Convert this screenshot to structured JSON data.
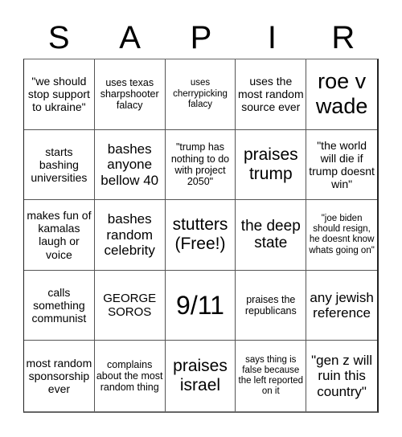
{
  "header": {
    "letters": [
      "S",
      "A",
      "P",
      "I",
      "R"
    ]
  },
  "cells": [
    {
      "text": "\"we should stop support to ukraine\"",
      "size": "s14"
    },
    {
      "text": "uses texas sharpshooter falacy",
      "size": "s12"
    },
    {
      "text": "uses cherrypicking falacy",
      "size": "s11"
    },
    {
      "text": "uses the most random source ever",
      "size": "s14"
    },
    {
      "text": "roe v wade",
      "size": "s27"
    },
    {
      "text": "starts bashing universities",
      "size": "s14"
    },
    {
      "text": "bashes anyone bellow 40",
      "size": "s17"
    },
    {
      "text": "\"trump has nothing to do with project 2050\"",
      "size": "s12"
    },
    {
      "text": "praises trump",
      "size": "s21"
    },
    {
      "text": "\"the world will die if trump doesnt win\"",
      "size": "s14"
    },
    {
      "text": "makes fun of kamalas laugh or voice",
      "size": "s14"
    },
    {
      "text": "bashes random celebrity",
      "size": "s17"
    },
    {
      "text": "stutters (Free!)",
      "size": "s21"
    },
    {
      "text": "the deep state",
      "size": "s19"
    },
    {
      "text": "\"joe biden should resign, he doesnt know whats going on\"",
      "size": "s11"
    },
    {
      "text": "calls something communist",
      "size": "s14"
    },
    {
      "text": "GEORGE SOROS",
      "size": "s15"
    },
    {
      "text": "9/11",
      "size": "s32"
    },
    {
      "text": "praises the republicans",
      "size": "s12"
    },
    {
      "text": "any jewish reference",
      "size": "s17"
    },
    {
      "text": "most random sponsorship ever",
      "size": "s14"
    },
    {
      "text": "complains about the most random thing",
      "size": "s12"
    },
    {
      "text": "praises israel",
      "size": "s21"
    },
    {
      "text": "says thing is false because the left reported on it",
      "size": "s11"
    },
    {
      "text": "\"gen z will ruin this country\"",
      "size": "s17"
    }
  ]
}
